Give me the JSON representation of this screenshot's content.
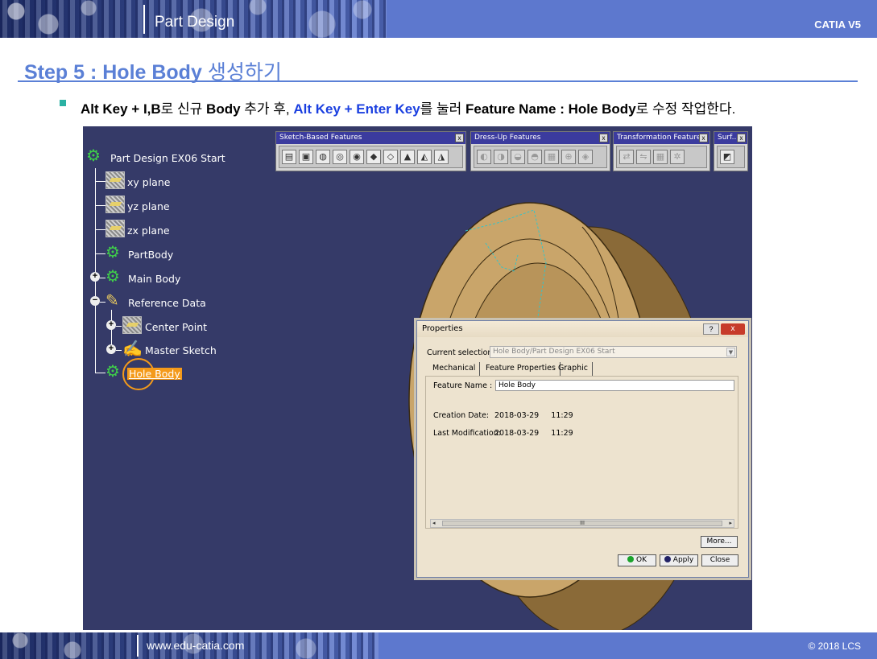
{
  "header": {
    "section_title": "Part Design",
    "brand": "CATIA V5"
  },
  "step": {
    "title_en": "Step 5 : Hole Body",
    "title_kr": "생성하기"
  },
  "instruction": {
    "part1_bold": "Alt Key + I,B",
    "part2": "로 신규 ",
    "part3_bold": "Body",
    "part4": " 추가 후, ",
    "part5_blue": "Alt Key + Enter Key",
    "part6": "를 눌러 ",
    "part7_bold": "Feature Name : Hole Body",
    "part8": "로 수정 작업한다."
  },
  "tree": {
    "root": "Part Design EX06 Start",
    "items": [
      {
        "label": "xy plane"
      },
      {
        "label": "yz plane"
      },
      {
        "label": "zx plane"
      },
      {
        "label": "PartBody"
      },
      {
        "label": "Main Body"
      },
      {
        "label": "Reference Data"
      },
      {
        "label": "Center Point"
      },
      {
        "label": "Master Sketch"
      },
      {
        "label": "Hole Body"
      }
    ],
    "expanders": {
      "plus": "+",
      "minus": "−"
    }
  },
  "toolbars": [
    {
      "title": "Sketch-Based Features",
      "close": "x"
    },
    {
      "title": "Dress-Up Features",
      "close": "x"
    },
    {
      "title": "Transformation Features",
      "close": "x"
    },
    {
      "title": "Surf...",
      "close": "x"
    }
  ],
  "dialog": {
    "title": "Properties",
    "help": "?",
    "close": "x",
    "current_selection_label": "Current selection :",
    "current_selection_value": "Hole Body/Part Design EX06 Start",
    "combo_arrow": "▼",
    "tabs": [
      "Mechanical",
      "Feature Properties",
      "Graphic"
    ],
    "feature_name_label": "Feature Name :",
    "feature_name_value": "Hole Body",
    "creation_date_label": "Creation Date:",
    "creation_date_value": "2018-03-29     11:29",
    "last_mod_label": "Last Modification:",
    "last_mod_value": "2018-03-29     11:29",
    "scroll_left": "◂",
    "scroll_right": "▸",
    "scroll_grip": "III",
    "more_button": "More...",
    "ok_button": "OK",
    "apply_button": "Apply",
    "close_button": "Close"
  },
  "footer": {
    "url": "www.edu-catia.com",
    "copyright": "© 2018 LCS"
  },
  "colors": {
    "header_bg": "#5d78ce",
    "title_blue": "#5b80d6",
    "viewport_bg": "#353a68",
    "selection_orange": "#f49a1a",
    "dialog_bg": "#ede3cf",
    "model_tan": "#c9a56a"
  }
}
